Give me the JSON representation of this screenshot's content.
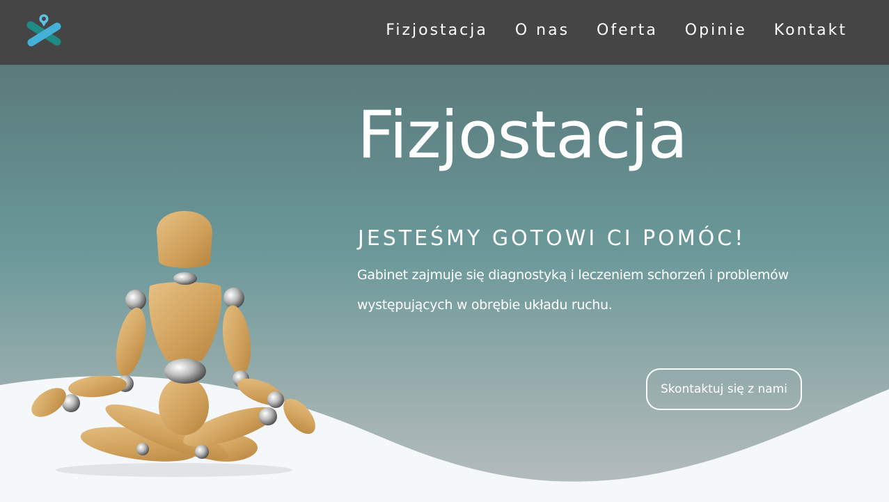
{
  "nav": {
    "logo_icon": "cross-pin-logo-icon",
    "links": [
      "Fizjostacja",
      "O nas",
      "Oferta",
      "Opinie",
      "Kontakt"
    ]
  },
  "hero": {
    "title": "Fizjostacja",
    "subtitle": "JESTEŚMY GOTOWI CI POMÓC!",
    "description": "Gabinet zajmuje się diagnostyką i leczeniem schorzeń i problemów występujących w obrębie układu ruchu.",
    "cta_label": "Skontaktuj się z nami",
    "image": "wooden-mannequin-meditating"
  },
  "colors": {
    "navbar": "#454546",
    "hero_gradient_top": "#5c7c7d",
    "hero_gradient_bottom": "#b6bcbe",
    "wave": "#f4f8fb",
    "logo_teal": "#1e8c84",
    "logo_blue": "#45b0d8",
    "text": "#ffffff"
  }
}
